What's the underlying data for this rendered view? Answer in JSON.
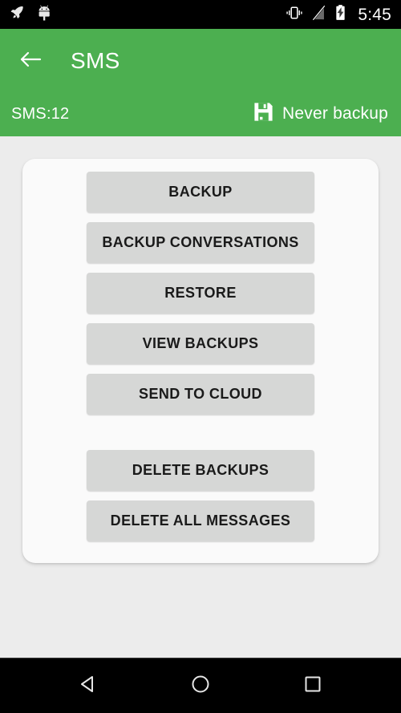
{
  "status_bar": {
    "left_icons": [
      {
        "name": "rocket-icon",
        "label": "rocket"
      },
      {
        "name": "android-robot-icon",
        "label": "android robot"
      }
    ],
    "right_icons": [
      {
        "name": "vibrate-icon",
        "label": "vibrate mode"
      },
      {
        "name": "signal-off-icon",
        "label": "no signal"
      },
      {
        "name": "battery-charging-icon",
        "label": "battery charging"
      }
    ],
    "clock": "5:45",
    "background_color": "#000000"
  },
  "appbar": {
    "back_icon": "arrow-left-icon",
    "title": "SMS",
    "sms_count_label": "SMS:12",
    "backup_status_icon": "floppy-save-icon",
    "backup_status_label": "Never backup",
    "background_color": "#4CAF50",
    "text_color": "#FFFFFF"
  },
  "content": {
    "card_background_color": "#FAFAFA",
    "page_background_color": "#ECECEC",
    "button_color": "#D6D7D6",
    "button_text_color": "#1A1A1A",
    "button_groups": [
      {
        "group_name": "backup-actions",
        "buttons": [
          {
            "name": "backup-button",
            "label": "BACKUP"
          },
          {
            "name": "backup-conversations-button",
            "label": "BACKUP CONVERSATIONS"
          },
          {
            "name": "restore-button",
            "label": "RESTORE"
          },
          {
            "name": "view-backups-button",
            "label": "VIEW BACKUPS"
          },
          {
            "name": "send-to-cloud-button",
            "label": "SEND TO CLOUD"
          }
        ]
      },
      {
        "group_name": "delete-actions",
        "buttons": [
          {
            "name": "delete-backups-button",
            "label": "DELETE BACKUPS"
          },
          {
            "name": "delete-all-messages-button",
            "label": "DELETE ALL MESSAGES"
          }
        ]
      }
    ]
  },
  "navbar": {
    "buttons": [
      {
        "name": "nav-back-button",
        "icon": "triangle-left-icon"
      },
      {
        "name": "nav-home-button",
        "icon": "circle-icon"
      },
      {
        "name": "nav-recents-button",
        "icon": "square-icon"
      }
    ],
    "background_color": "#000000"
  }
}
